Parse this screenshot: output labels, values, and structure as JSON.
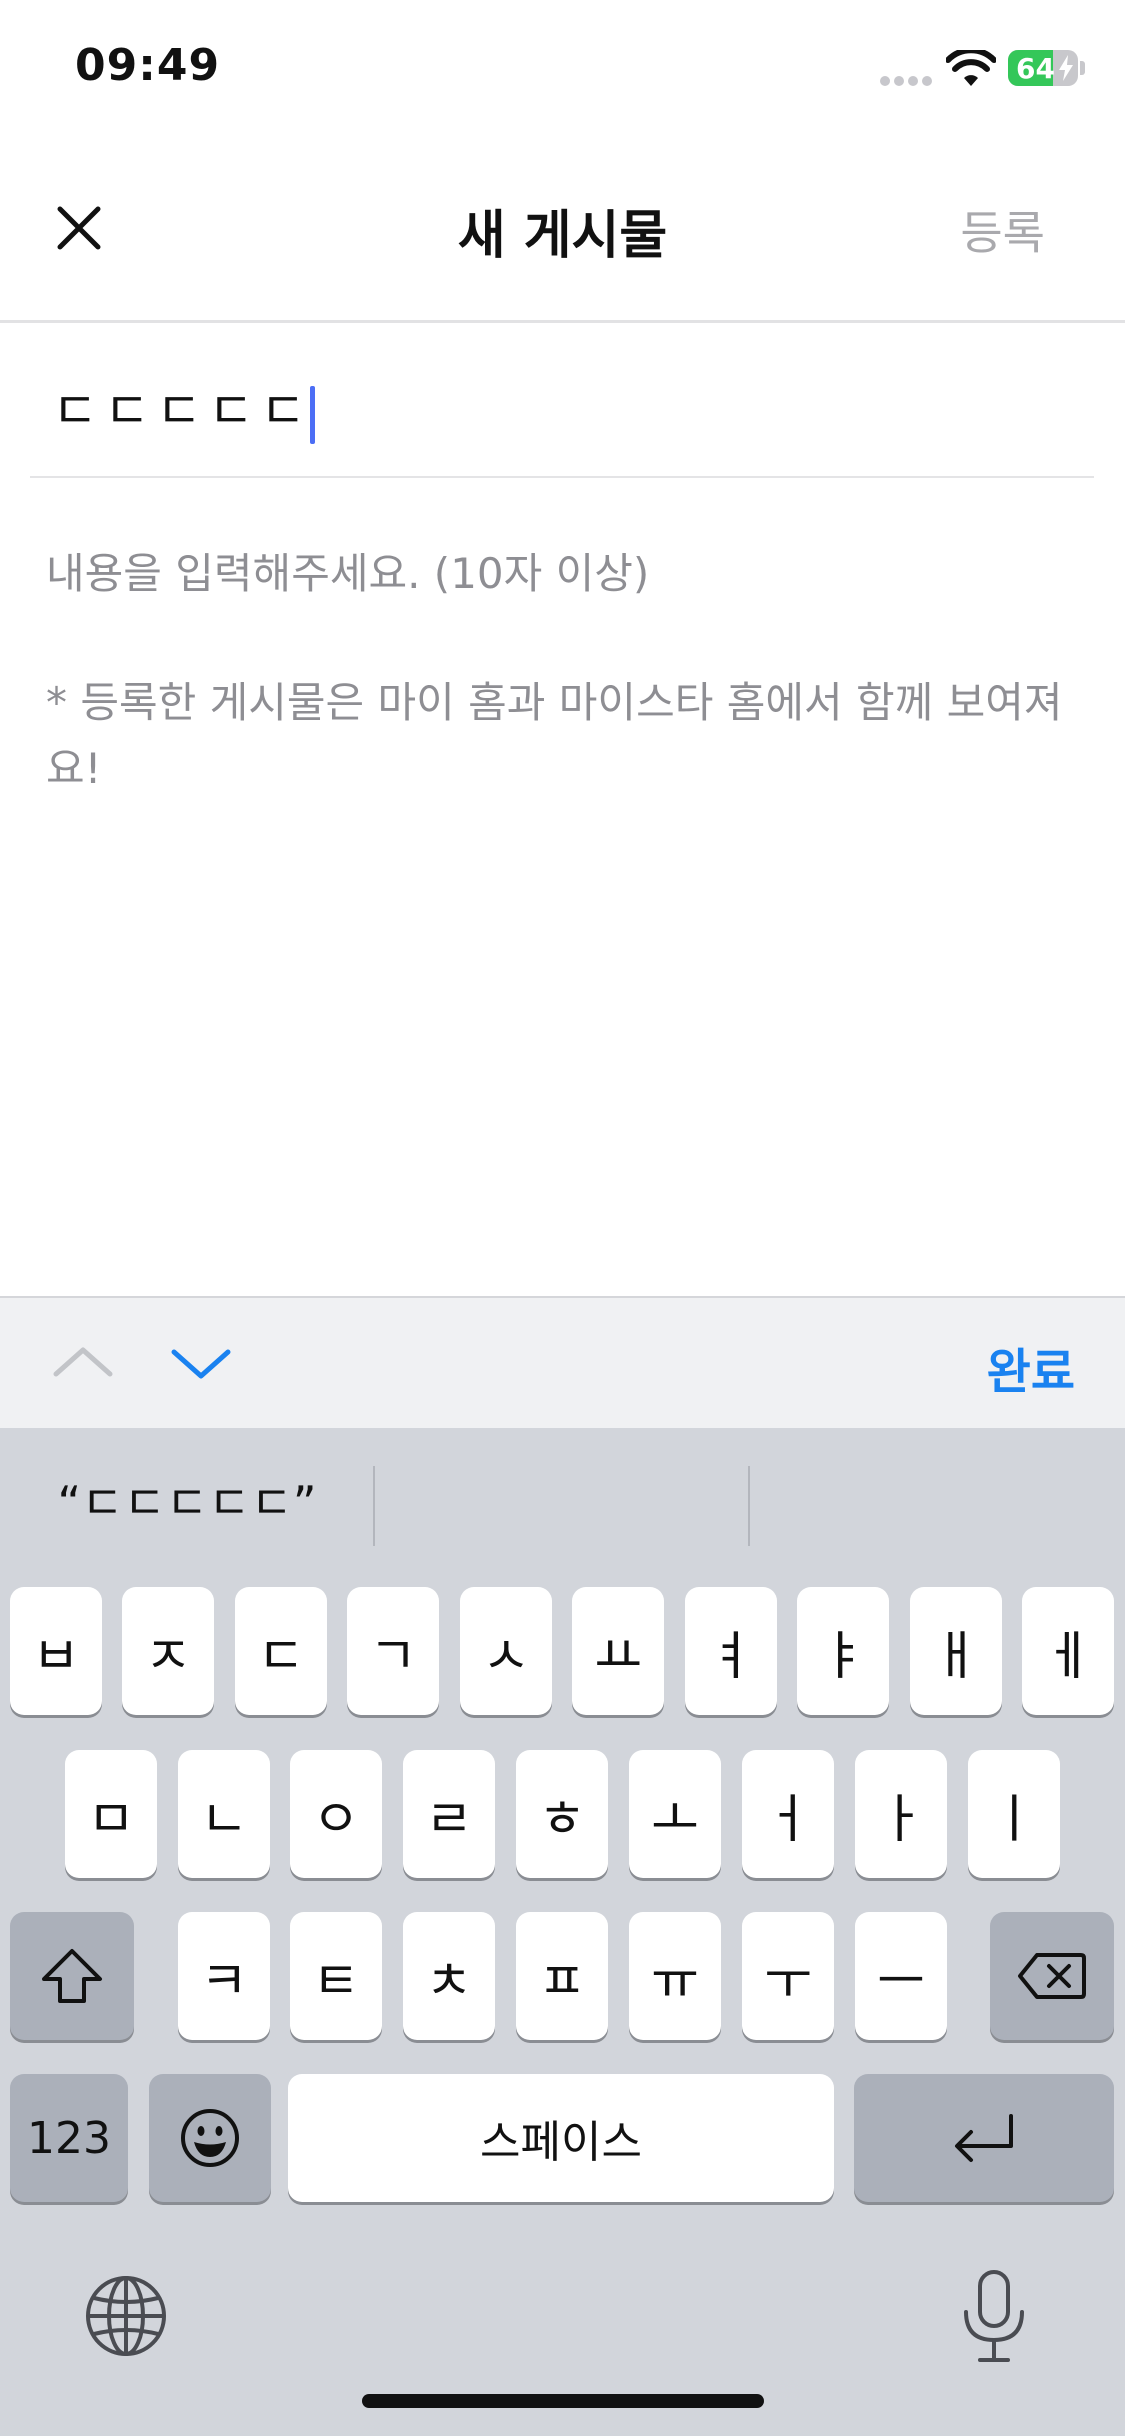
{
  "status_bar": {
    "time": "09:49",
    "battery_percent": "64",
    "battery_level": 0.64,
    "battery_color": "#34c759"
  },
  "nav": {
    "close_icon": "close-icon",
    "title": "새 게시물",
    "submit_label": "등록"
  },
  "form": {
    "title_value": "ㄷㄷㄷㄷㄷ",
    "content_placeholder": "내용을 입력해주세요. (10자 이상)",
    "notice_line1": "* 등록한 게시물은 마이 홈과 마이스타 홈에서 함께 보여져",
    "notice_line2": "요!"
  },
  "accessory_bar": {
    "prev_icon": "chevron-up-icon",
    "next_icon": "chevron-down-icon",
    "done_label": "완료"
  },
  "keyboard": {
    "suggestions": [
      "“ㄷㄷㄷㄷㄷ”",
      "",
      ""
    ],
    "row1": [
      "ㅂ",
      "ㅈ",
      "ㄷ",
      "ㄱ",
      "ㅅ",
      "ㅛ",
      "ㅕ",
      "ㅑ",
      "ㅐ",
      "ㅔ"
    ],
    "row2": [
      "ㅁ",
      "ㄴ",
      "ㅇ",
      "ㄹ",
      "ㅎ",
      "ㅗ",
      "ㅓ",
      "ㅏ",
      "ㅣ"
    ],
    "row3": [
      "ㅋ",
      "ㅌ",
      "ㅊ",
      "ㅍ",
      "ㅠ",
      "ㅜ",
      "ㅡ"
    ],
    "numbers_label": "123",
    "space_label": "스페이스",
    "shift_icon": "shift-icon",
    "delete_icon": "delete-icon",
    "emoji_icon": "emoji-icon",
    "return_icon": "return-icon",
    "globe_icon": "globe-icon",
    "mic_icon": "microphone-icon"
  },
  "colors": {
    "accent": "#1a82f0",
    "caret": "#4c6ef5",
    "placeholder": "#8e8e93",
    "keyboard_bg": "#d2d5db"
  }
}
